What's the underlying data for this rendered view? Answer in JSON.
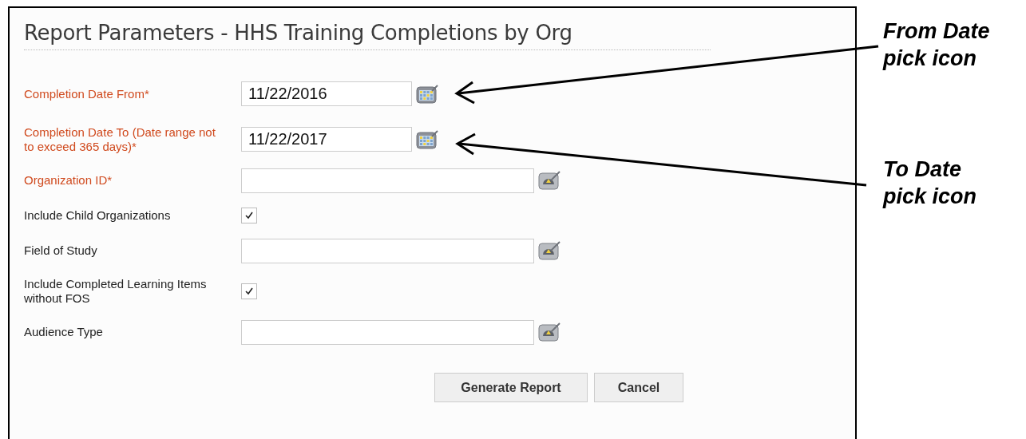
{
  "title": "Report Parameters - HHS Training Completions by Org",
  "fields": [
    {
      "kind": "date",
      "label": "Completion Date From*",
      "required": true,
      "value": "11/22/2016"
    },
    {
      "kind": "date",
      "label": "Completion Date To (Date range not to exceed 365 days)*",
      "required": true,
      "value": "11/22/2017"
    },
    {
      "kind": "lookup",
      "label": "Organization ID*",
      "required": true
    },
    {
      "kind": "checkbox",
      "label": "Include Child Organizations",
      "required": false,
      "checked": true
    },
    {
      "kind": "lookup",
      "label": "Field of Study",
      "required": false
    },
    {
      "kind": "checkbox",
      "label": "Include Completed Learning Items without FOS",
      "required": false,
      "checked": true
    },
    {
      "kind": "lookup",
      "label": "Audience Type",
      "required": false
    }
  ],
  "buttons": [
    "Generate Report",
    "Cancel"
  ],
  "callouts": [
    "From Date pick icon",
    "To Date pick icon"
  ]
}
